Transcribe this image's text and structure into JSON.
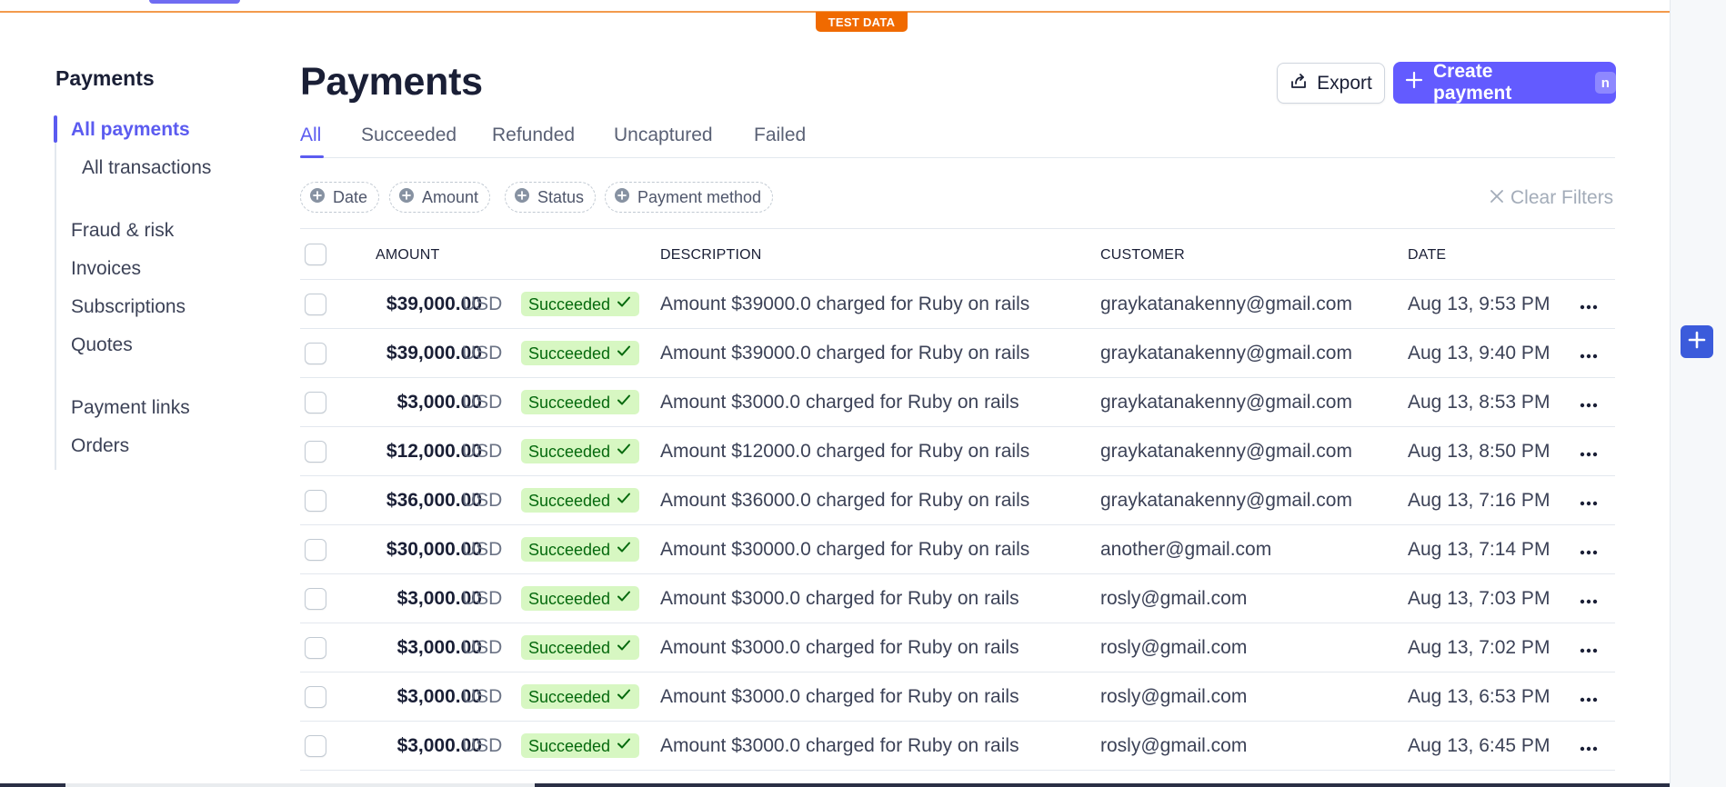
{
  "banner": {
    "test_data": "TEST DATA"
  },
  "sidebar": {
    "title": "Payments",
    "items": [
      {
        "label": "All payments",
        "active": true
      },
      {
        "label": "All transactions"
      },
      {
        "label": "Fraud & risk"
      },
      {
        "label": "Invoices"
      },
      {
        "label": "Subscriptions"
      },
      {
        "label": "Quotes"
      },
      {
        "label": "Payment links"
      },
      {
        "label": "Orders"
      }
    ]
  },
  "header": {
    "title": "Payments",
    "export_label": "Export",
    "create_label": "Create payment",
    "create_shortcut": "n"
  },
  "tabs": [
    {
      "label": "All",
      "active": true
    },
    {
      "label": "Succeeded"
    },
    {
      "label": "Refunded"
    },
    {
      "label": "Uncaptured"
    },
    {
      "label": "Failed"
    }
  ],
  "filters": {
    "chips": [
      "Date",
      "Amount",
      "Status",
      "Payment method"
    ],
    "clear_label": "Clear Filters"
  },
  "table": {
    "columns": {
      "amount": "AMOUNT",
      "description": "DESCRIPTION",
      "customer": "CUSTOMER",
      "date": "DATE"
    },
    "rows": [
      {
        "amount": "$39,000.00",
        "currency": "USD",
        "status": "Succeeded",
        "description": "Amount $39000.0 charged for Ruby on rails",
        "customer": "graykatanakenny@gmail.com",
        "date": "Aug 13, 9:53 PM"
      },
      {
        "amount": "$39,000.00",
        "currency": "USD",
        "status": "Succeeded",
        "description": "Amount $39000.0 charged for Ruby on rails",
        "customer": "graykatanakenny@gmail.com",
        "date": "Aug 13, 9:40 PM"
      },
      {
        "amount": "$3,000.00",
        "currency": "USD",
        "status": "Succeeded",
        "description": "Amount $3000.0 charged for Ruby on rails",
        "customer": "graykatanakenny@gmail.com",
        "date": "Aug 13, 8:53 PM"
      },
      {
        "amount": "$12,000.00",
        "currency": "USD",
        "status": "Succeeded",
        "description": "Amount $12000.0 charged for Ruby on rails",
        "customer": "graykatanakenny@gmail.com",
        "date": "Aug 13, 8:50 PM"
      },
      {
        "amount": "$36,000.00",
        "currency": "USD",
        "status": "Succeeded",
        "description": "Amount $36000.0 charged for Ruby on rails",
        "customer": "graykatanakenny@gmail.com",
        "date": "Aug 13, 7:16 PM"
      },
      {
        "amount": "$30,000.00",
        "currency": "USD",
        "status": "Succeeded",
        "description": "Amount $30000.0 charged for Ruby on rails",
        "customer": "another@gmail.com",
        "date": "Aug 13, 7:14 PM"
      },
      {
        "amount": "$3,000.00",
        "currency": "USD",
        "status": "Succeeded",
        "description": "Amount $3000.0 charged for Ruby on rails",
        "customer": "rosly@gmail.com",
        "date": "Aug 13, 7:03 PM"
      },
      {
        "amount": "$3,000.00",
        "currency": "USD",
        "status": "Succeeded",
        "description": "Amount $3000.0 charged for Ruby on rails",
        "customer": "rosly@gmail.com",
        "date": "Aug 13, 7:02 PM"
      },
      {
        "amount": "$3,000.00",
        "currency": "USD",
        "status": "Succeeded",
        "description": "Amount $3000.0 charged for Ruby on rails",
        "customer": "rosly@gmail.com",
        "date": "Aug 13, 6:53 PM"
      },
      {
        "amount": "$3,000.00",
        "currency": "USD",
        "status": "Succeeded",
        "description": "Amount $3000.0 charged for Ruby on rails",
        "customer": "rosly@gmail.com",
        "date": "Aug 13, 6:45 PM"
      }
    ]
  },
  "colors": {
    "accent": "#635bff",
    "test_badge": "#f06a00",
    "success_bg": "#d7f7c2",
    "success_text": "#05690d"
  },
  "icons": {
    "export": "export-icon",
    "create": "plus-icon",
    "filter_chip": "plus-circle-icon",
    "clear": "close-icon",
    "status": "checkmark-icon",
    "row_menu": "more-horizontal-icon",
    "floating": "plus-icon"
  }
}
